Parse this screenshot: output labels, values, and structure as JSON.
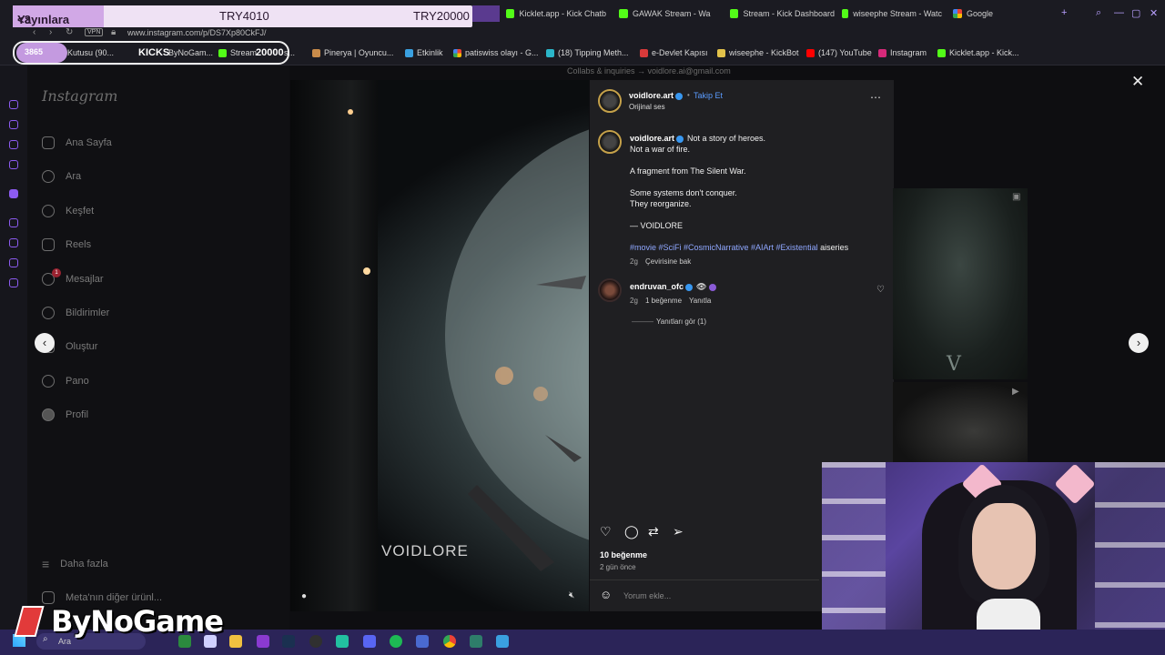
{
  "overlay": {
    "donate_label": "Yayınlara Destek",
    "donate_heart": "<3",
    "goal_current": "TRY4010",
    "goal_target": "TRY20000",
    "kicks_count": "3865",
    "kicks_label": "KICKS",
    "kicks_target": "20000",
    "brand": "ByNoGame"
  },
  "browser": {
    "tabs": [
      {
        "label": "Kicklet.app - Kick Chatb",
        "icon": "kick-icon"
      },
      {
        "label": "GAWAK Stream - Wa",
        "icon": "kick-icon"
      },
      {
        "label": "Stream - Kick Dashboard",
        "icon": "kick-icon"
      },
      {
        "label": "wiseephe Stream - Watc",
        "icon": "kick-icon"
      },
      {
        "label": "Google",
        "icon": "google-icon"
      }
    ],
    "new_tab": "+",
    "url": "www.instagram.com/p/DS7Xp80CkFJ/",
    "vpn": "VPN",
    "ai_label": "AI",
    "bookmarks": [
      {
        "label": "Kutusu (90..."
      },
      {
        "label": "ByNoGam..."
      },
      {
        "label": "Stream"
      },
      {
        "label": "s..."
      },
      {
        "label": "Pinerya | Oyuncu..."
      },
      {
        "label": "Etkinlik"
      },
      {
        "label": "patiswiss olayı - G..."
      },
      {
        "label": "(18) Tipping Meth..."
      },
      {
        "label": "e-Devlet Kapısı"
      },
      {
        "label": "wiseephe - KickBot"
      },
      {
        "label": "(147) YouTube"
      },
      {
        "label": "Instagram"
      },
      {
        "label": "Kicklet.app - Kick..."
      }
    ]
  },
  "instagram": {
    "logo": "Instagram",
    "nav": [
      {
        "label": "Ana Sayfa",
        "icon": "home-icon"
      },
      {
        "label": "Ara",
        "icon": "search-icon"
      },
      {
        "label": "Keşfet",
        "icon": "compass-icon"
      },
      {
        "label": "Reels",
        "icon": "reels-icon"
      },
      {
        "label": "Mesajlar",
        "icon": "messenger-icon"
      },
      {
        "label": "Bildirimler",
        "icon": "heart-icon"
      },
      {
        "label": "Oluştur",
        "icon": "plus-icon"
      },
      {
        "label": "Pano",
        "icon": "dashboard-icon"
      },
      {
        "label": "Profil",
        "icon": "profile-icon"
      }
    ],
    "messages_badge": "1",
    "more": "Daha fazla",
    "meta": "Meta'nın diğer ürünl...",
    "collab": "Collabs & inquiries → voidlore.ai@gmail.com"
  },
  "video": {
    "watermark": "VOIDLORE"
  },
  "post": {
    "author": "voidlore.art",
    "follow": "Takip Et",
    "audio": "Orijinal ses",
    "caption_author": "voidlore.art",
    "caption_lines": [
      "Not a story of heroes.",
      "Not a war of fire.",
      "A fragment from The Silent War.",
      "Some systems don't conquer.",
      "They reorganize.",
      "— VOIDLORE"
    ],
    "hashtags": "#movie #SciFi #CosmicNarrative #AIArt #Existential",
    "hashtag_tail": "aiseries",
    "caption_age": "2g",
    "see_translation": "Çevirisine bak",
    "comment": {
      "author": "endruvan_ofc",
      "age": "2g",
      "likes": "1 beğenme",
      "reply": "Yanıtla",
      "view_replies": "Yanıtları gör (1)"
    },
    "likes": "10 beğenme",
    "age": "2 gün önce",
    "comment_placeholder": "Yorum ekle..."
  },
  "taskbar": {
    "search": "Ara"
  },
  "colors": {
    "accent": "#3897f0",
    "overlay_bg": "#efe2f4",
    "taskbar": "#2b2458"
  }
}
